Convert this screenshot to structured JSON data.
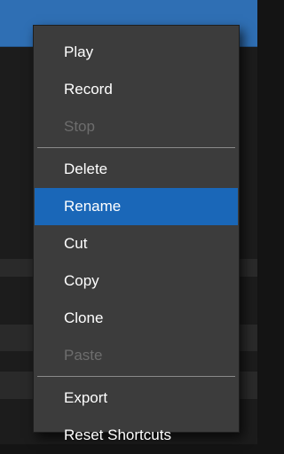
{
  "context_menu": {
    "groups": [
      [
        {
          "label": "Play",
          "enabled": true
        },
        {
          "label": "Record",
          "enabled": true
        },
        {
          "label": "Stop",
          "enabled": false
        }
      ],
      [
        {
          "label": "Delete",
          "enabled": true
        },
        {
          "label": "Rename",
          "enabled": true,
          "selected": true
        },
        {
          "label": "Cut",
          "enabled": true
        },
        {
          "label": "Copy",
          "enabled": true
        },
        {
          "label": "Clone",
          "enabled": true
        },
        {
          "label": "Paste",
          "enabled": false
        }
      ],
      [
        {
          "label": "Export",
          "enabled": true
        },
        {
          "label": "Reset Shortcuts",
          "enabled": true
        }
      ]
    ],
    "selected_color": "#1a67b8",
    "disabled_color": "#6d6d6d"
  }
}
